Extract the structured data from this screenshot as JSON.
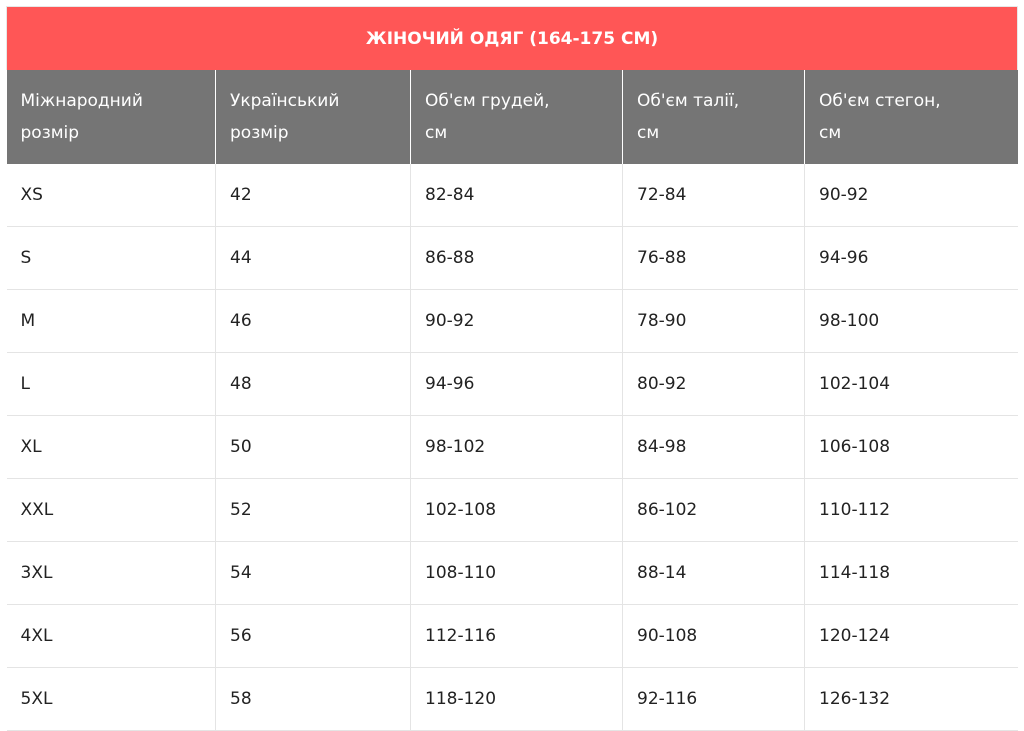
{
  "table": {
    "title": "ЖІНОЧИЙ ОДЯГ (164-175 СМ)",
    "headers": [
      [
        "Міжнародний",
        "розмір"
      ],
      [
        "Український",
        "розмір"
      ],
      [
        "Об'єм грудей,",
        "см"
      ],
      [
        "Об'єм талії,",
        "см"
      ],
      [
        "Об'єм стегон,",
        "см"
      ]
    ],
    "rows": [
      [
        "XS",
        "42",
        "82-84",
        "72-84",
        "90-92"
      ],
      [
        "S",
        "44",
        "86-88",
        "76-88",
        "94-96"
      ],
      [
        "M",
        "46",
        "90-92",
        "78-90",
        "98-100"
      ],
      [
        "L",
        "48",
        "94-96",
        "80-92",
        "102-104"
      ],
      [
        "XL",
        "50",
        "98-102",
        "84-98",
        "106-108"
      ],
      [
        "XXL",
        "52",
        "102-108",
        "86-102",
        "110-112"
      ],
      [
        "3XL",
        "54",
        "108-110",
        "88-14",
        "114-118"
      ],
      [
        "4XL",
        "56",
        "112-116",
        "90-108",
        "120-124"
      ],
      [
        "5XL",
        "58",
        "118-120",
        "92-116",
        "126-132"
      ]
    ]
  },
  "colors": {
    "title_bg": "#ff5656",
    "header_bg": "#757575",
    "border": "#e4e4e4"
  }
}
